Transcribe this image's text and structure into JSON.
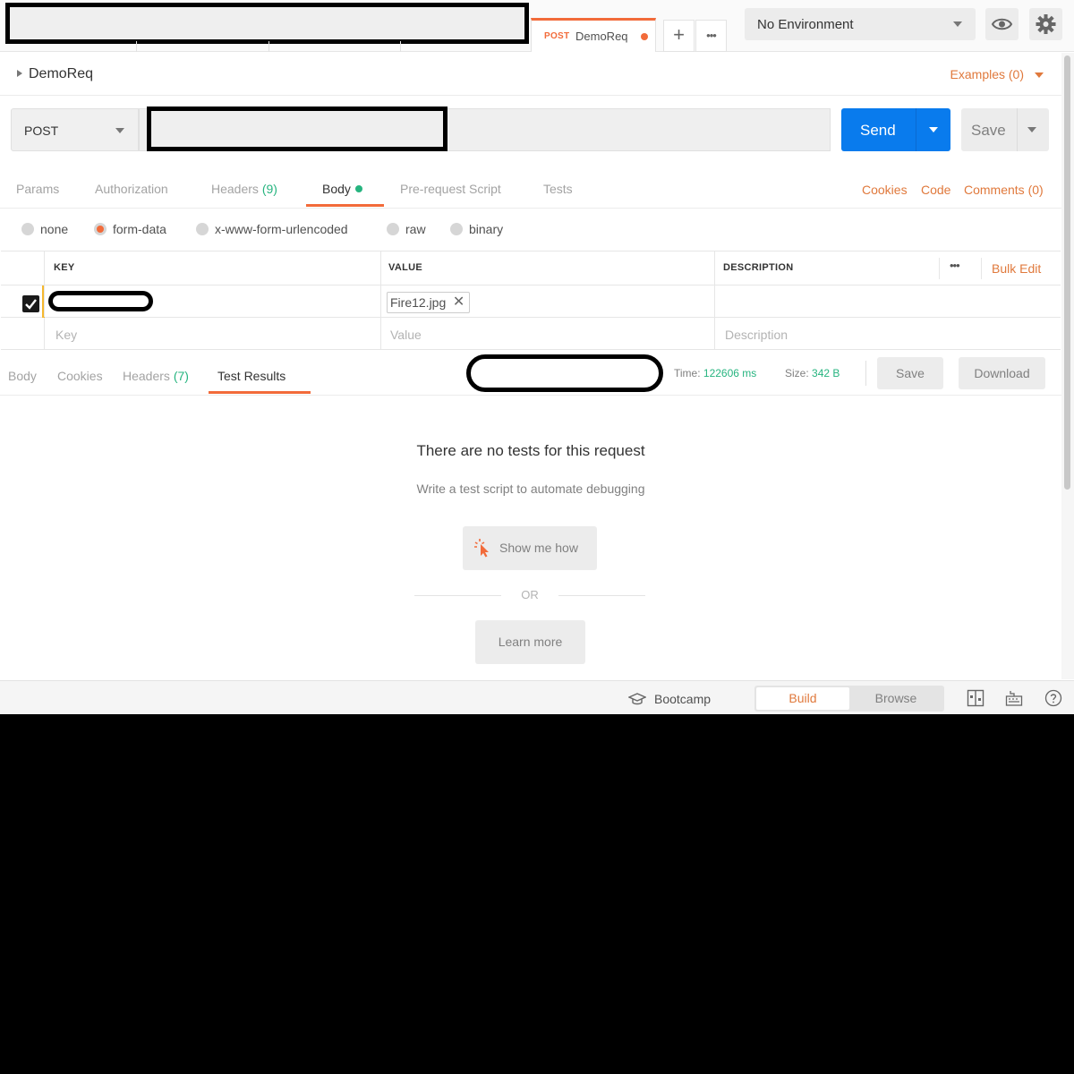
{
  "tabbar": {
    "active_tab": {
      "method": "POST",
      "name": "DemoReq"
    },
    "new_tab_label": "+",
    "more_label": "•••"
  },
  "environment": {
    "selected": "No Environment"
  },
  "request": {
    "name": "DemoReq",
    "examples_label": "Examples (0)",
    "method": "POST",
    "send_label": "Send",
    "save_label": "Save"
  },
  "request_tabs": [
    {
      "label": "Params"
    },
    {
      "label": "Authorization"
    },
    {
      "label": "Headers",
      "count": "(9)"
    },
    {
      "label": "Body"
    },
    {
      "label": "Pre-request Script"
    },
    {
      "label": "Tests"
    }
  ],
  "request_links": {
    "cookies": "Cookies",
    "code": "Code",
    "comments": "Comments (0)"
  },
  "body_types": {
    "options": [
      "none",
      "form-data",
      "x-www-form-urlencoded",
      "raw",
      "binary"
    ],
    "selected": "form-data"
  },
  "kv_table": {
    "headers": {
      "key": "KEY",
      "value": "VALUE",
      "description": "DESCRIPTION"
    },
    "bulk_edit": "Bulk Edit",
    "rows": [
      {
        "checked": true,
        "value_file": "Fire12.jpg"
      }
    ],
    "placeholders": {
      "key": "Key",
      "value": "Value",
      "description": "Description"
    }
  },
  "response": {
    "tabs": [
      {
        "label": "Body"
      },
      {
        "label": "Cookies"
      },
      {
        "label": "Headers",
        "count": "(7)"
      },
      {
        "label": "Test Results"
      }
    ],
    "time_label": "Time:",
    "time_value": "122606 ms",
    "size_label": "Size:",
    "size_value": "342 B",
    "save_label": "Save",
    "download_label": "Download"
  },
  "empty_state": {
    "title": "There are no tests for this request",
    "subtitle": "Write a test script to automate debugging",
    "show_me": "Show me how",
    "or": "OR",
    "learn_more": "Learn more"
  },
  "status_bar": {
    "bootcamp": "Bootcamp",
    "build": "Build",
    "browse": "Browse"
  },
  "colors": {
    "accent": "#f26b3a",
    "link": "#e0793c",
    "primary": "#097bed",
    "success": "#26b47f"
  }
}
